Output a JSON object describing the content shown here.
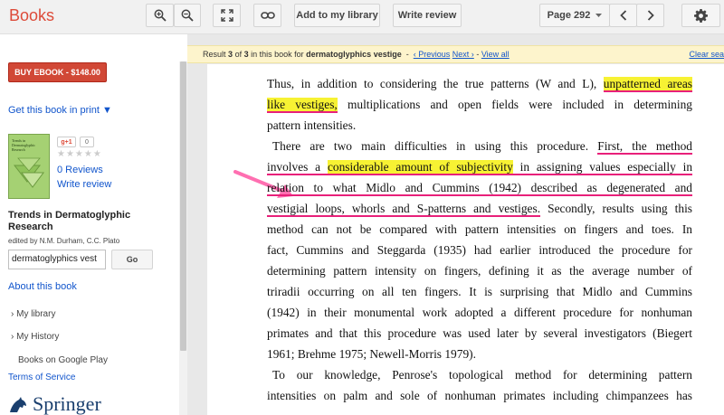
{
  "app": {
    "logo": "Books"
  },
  "toolbar": {
    "add_library": "Add to my library",
    "write_review": "Write review",
    "page_label": "Page 292"
  },
  "sidebar": {
    "buy_button": "BUY EBOOK - $148.00",
    "get_print": "Get this book in print ▼",
    "gplus": "g+1",
    "gplus_count": "0",
    "stars": "★★★★★",
    "reviews": "0 Reviews",
    "write_review": "Write review",
    "book_title": "Trends in Dermatoglyphic Research",
    "editors": "edited by N.M. Durham, C.C. Plato",
    "cover_text": "Trends in Dermatoglyphic Research",
    "search_value": "dermatoglyphics vest",
    "go_button": "Go",
    "about": "About this book",
    "my_library": "› My library",
    "my_history": "› My History",
    "google_play": "Books on Google Play",
    "terms": "Terms of Service",
    "publisher": "Springer"
  },
  "result": {
    "prefix": "Result",
    "current": "3",
    "of": "of",
    "total": "3",
    "in_book": "in this book for",
    "query": "dermatoglyphics vestige",
    "dash": "-",
    "previous": "‹ Previous",
    "next": "Next ›",
    "separator": "-",
    "view_all": "View all",
    "clear": "Clear sea"
  },
  "page_text": {
    "l1a": "Thus, in addition to considering the true patterns (W and L), ",
    "l1b": "unpatterned areas",
    "l2a": "like vestiges,",
    "l2b": " multiplications and open fields were included in determining",
    "l3": "pattern intensities.",
    "l4a": "There are two main difficulties in using this procedure. ",
    "l4b": "First, the method",
    "l5a": "involves a ",
    "l5b": "considerable amount of subjectivity",
    "l5c": " in assigning values especially in",
    "l6": "relation to what Midlo and Cummins (1942) described as degenerated and",
    "l7a": "vestigial loops, whorls and S-patterns and vestiges.",
    "l7b": " Secondly, results using this",
    "l8": "method can not be compared with pattern intensities on fingers and toes.  In",
    "l9": "fact, Cummins and Steggarda (1935) had earlier introduced the procedure for",
    "l10": "determining pattern intensity on fingers, defining it as the average number of",
    "l11": "triradii occurring on all ten fingers.  It is surprising that Midlo and Cummins",
    "l12": "(1942) in their monumental work adopted a different procedure for nonhuman",
    "l13": "primates and that this procedure was used later by several investigators (Biegert",
    "l14": "1961; Brehme 1975; Newell-Morris 1979).",
    "l15": "To our knowledge, Penrose's topological method for determining pattern",
    "l16": "intensities on palm and sole of nonhuman primates including chimpanzees has"
  },
  "colors": {
    "highlight": "#f7f233",
    "underline": "#e8207a",
    "brand": "#dd4b39",
    "buy": "#d14836"
  },
  "icons": [
    "zoom-in-icon",
    "zoom-out-icon",
    "fullscreen-icon",
    "link-icon",
    "dropdown-icon",
    "chevron-left-icon",
    "chevron-right-icon",
    "gear-icon",
    "pink-arrow-icon"
  ]
}
